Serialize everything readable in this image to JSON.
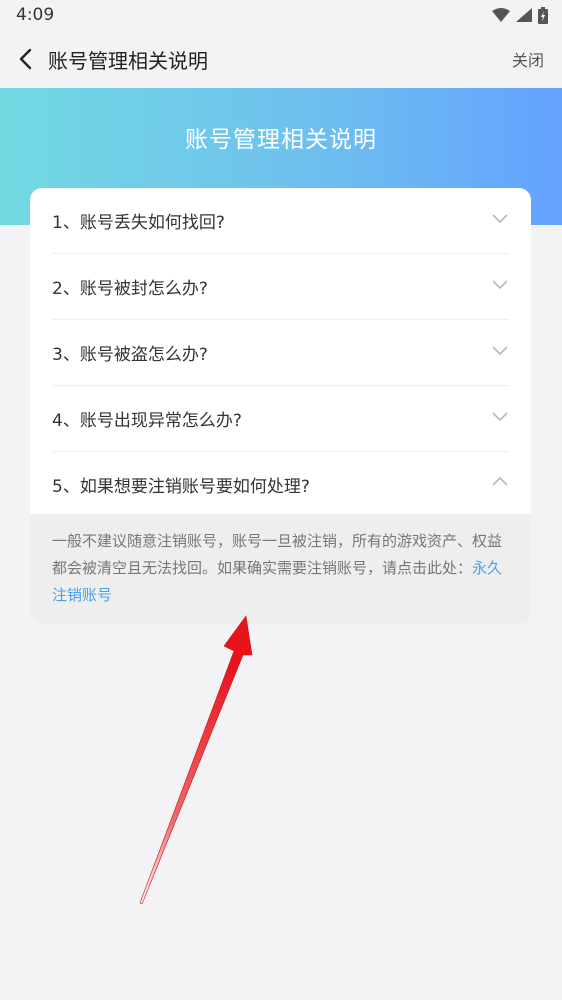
{
  "status": {
    "time": "4:09"
  },
  "nav": {
    "title": "账号管理相关说明",
    "close_label": "关闭"
  },
  "banner": {
    "title": "账号管理相关说明"
  },
  "faq": [
    {
      "question": "1、账号丢失如何找回?",
      "expanded": false
    },
    {
      "question": "2、账号被封怎么办?",
      "expanded": false
    },
    {
      "question": "3、账号被盗怎么办?",
      "expanded": false
    },
    {
      "question": "4、账号出现异常怎么办?",
      "expanded": false
    },
    {
      "question": "5、如果想要注销账号要如何处理?",
      "expanded": true
    }
  ],
  "answer": {
    "text": "一般不建议随意注销账号，账号一旦被注销，所有的游戏资产、权益都会被清空且无法找回。如果确实需要注销账号，请点击此处：",
    "link": "永久注销账号"
  },
  "colors": {
    "link": "#4a9fea",
    "arrow": "#e8131b",
    "banner_start": "#72d9e2",
    "banner_end": "#63a2ff"
  }
}
